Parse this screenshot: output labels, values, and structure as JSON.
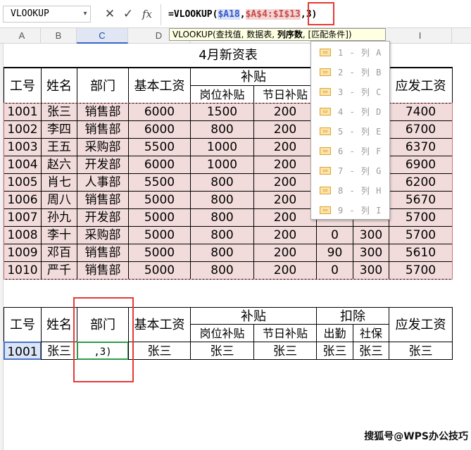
{
  "formula_bar": {
    "name_box": "VLOOKUP",
    "cancel_icon": "✕",
    "confirm_icon": "✓",
    "fx_label": "fx",
    "formula_prefix": "=VLOOKUP(",
    "arg1": "$A18",
    "comma1": ",",
    "arg2": "$A$4:$I$13",
    "comma2": ",",
    "arg3": "3)"
  },
  "tooltip": {
    "func": "VLOOKUP",
    "args_plain": "(查找值, 数据表, ",
    "args_current": "列序数",
    "args_tail": ", [匹配条件])"
  },
  "columns": [
    "A",
    "B",
    "C",
    "D",
    "I"
  ],
  "table1": {
    "title": "4月新资表",
    "headers": {
      "id": "工号",
      "name": "姓名",
      "dept": "部门",
      "base": "基本工资",
      "allowance": "补贴",
      "post": "岗位补贴",
      "holiday": "节日补贴",
      "pay": "应发工资"
    },
    "rows": [
      {
        "id": "1001",
        "name": "张三",
        "dept": "销售部",
        "base": "6000",
        "post": "1500",
        "holiday": "200",
        "pay": "7400"
      },
      {
        "id": "1002",
        "name": "李四",
        "dept": "销售部",
        "base": "6000",
        "post": "800",
        "holiday": "200",
        "pay": "6700"
      },
      {
        "id": "1003",
        "name": "王五",
        "dept": "采购部",
        "base": "5500",
        "post": "1000",
        "holiday": "200",
        "pay": "6370"
      },
      {
        "id": "1004",
        "name": "赵六",
        "dept": "开发部",
        "base": "6000",
        "post": "1000",
        "holiday": "200",
        "pay": "6900"
      },
      {
        "id": "1005",
        "name": "肖七",
        "dept": "人事部",
        "base": "5500",
        "post": "800",
        "holiday": "200",
        "pay": "6200"
      },
      {
        "id": "1006",
        "name": "周八",
        "dept": "销售部",
        "base": "5000",
        "post": "800",
        "holiday": "200",
        "pay": "5670"
      },
      {
        "id": "1007",
        "name": "孙九",
        "dept": "开发部",
        "base": "5000",
        "post": "800",
        "holiday": "200",
        "pay": "5700"
      },
      {
        "id": "1008",
        "name": "李十",
        "dept": "采购部",
        "base": "5000",
        "post": "800",
        "holiday": "200",
        "attend": "0",
        "social": "300",
        "pay": "5700"
      },
      {
        "id": "1009",
        "name": "邓百",
        "dept": "销售部",
        "base": "5000",
        "post": "800",
        "holiday": "200",
        "attend": "90",
        "social": "300",
        "pay": "5610"
      },
      {
        "id": "1010",
        "name": "严千",
        "dept": "销售部",
        "base": "5000",
        "post": "800",
        "holiday": "200",
        "attend": "0",
        "social": "300",
        "pay": "5700"
      }
    ]
  },
  "dropdown": {
    "icon": "▭",
    "items": [
      "1 - 列 A",
      "2 - 列 B",
      "3 - 列 C",
      "4 - 列 D",
      "5 - 列 E",
      "6 - 列 F",
      "7 - 列 G",
      "8 - 列 H",
      "9 - 列 I"
    ]
  },
  "table2": {
    "headers": {
      "id": "工号",
      "name": "姓名",
      "dept": "部门",
      "base": "基本工资",
      "allowance": "补贴",
      "post": "岗位补贴",
      "holiday": "节日补贴",
      "deduct": "扣除",
      "attend": "出勤",
      "social": "社保",
      "pay": "应发工资"
    },
    "row": {
      "id": "1001",
      "name": "张三",
      "dept_edit": ",3)",
      "base": "张三",
      "post": "张三",
      "holiday": "张三",
      "attend": "张三",
      "social": "张三",
      "pay": "张三"
    }
  },
  "watermark": "搜狐号@WPS办公技巧",
  "colors": {
    "pink_fill": "#f2dcdb",
    "ref1": "#3a56c5",
    "ref2": "#c44b4b",
    "highlight": "#e53935"
  }
}
